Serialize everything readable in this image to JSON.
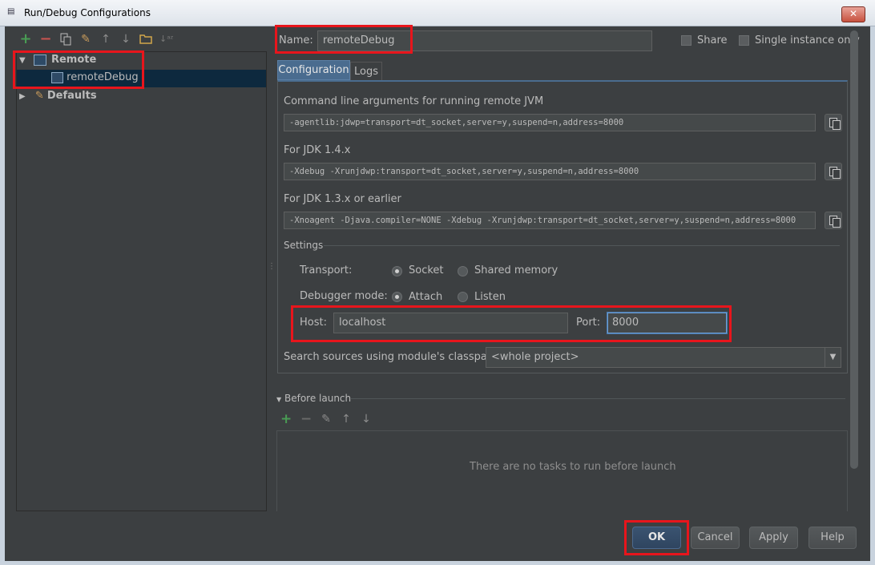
{
  "window": {
    "title": "Run/Debug Configurations",
    "close_glyph": "✕"
  },
  "toolbar": {
    "icons": [
      "add-icon",
      "remove-icon",
      "copy-icon",
      "edit-defaults-icon",
      "move-up-icon",
      "move-down-icon",
      "folder-icon",
      "sort-icon"
    ]
  },
  "tree": {
    "remote_label": "Remote",
    "remote_debug_label": "remoteDebug",
    "defaults_label": "Defaults"
  },
  "form": {
    "name_label": "Name:",
    "name_value": "remoteDebug",
    "share_label": "Share",
    "single_instance_label": "Single instance only",
    "tabs": [
      {
        "label": "Configuration"
      },
      {
        "label": "Logs"
      }
    ],
    "cmd_label": "Command line arguments for running remote JVM",
    "cmd_value": "-agentlib:jdwp=transport=dt_socket,server=y,suspend=n,address=8000",
    "jdk14_label": "For JDK 1.4.x",
    "jdk14_value": "-Xdebug -Xrunjdwp:transport=dt_socket,server=y,suspend=n,address=8000",
    "jdk13_label": "For JDK 1.3.x or earlier",
    "jdk13_value": "-Xnoagent -Djava.compiler=NONE -Xdebug -Xrunjdwp:transport=dt_socket,server=y,suspend=n,address=8000",
    "settings_label": "Settings",
    "transport_label": "Transport:",
    "transport_options": [
      "Socket",
      "Shared memory"
    ],
    "transport_selected": "Socket",
    "debugger_mode_label": "Debugger mode:",
    "debugger_mode_options": [
      "Attach",
      "Listen"
    ],
    "debugger_mode_selected": "Attach",
    "host_label": "Host:",
    "host_value": "localhost",
    "port_label": "Port:",
    "port_value": "8000",
    "search_sources_label": "Search sources using module's classpath:",
    "search_sources_value": "<whole project>"
  },
  "before_launch": {
    "label": "Before launch",
    "empty_text": "There are no tasks to run before launch"
  },
  "buttons": {
    "ok": "OK",
    "cancel": "Cancel",
    "apply": "Apply",
    "help": "Help"
  },
  "colors": {
    "add": "#499c54",
    "remove": "#c75450",
    "highlight_box": "#e8151c",
    "selection": "#0d293e"
  }
}
